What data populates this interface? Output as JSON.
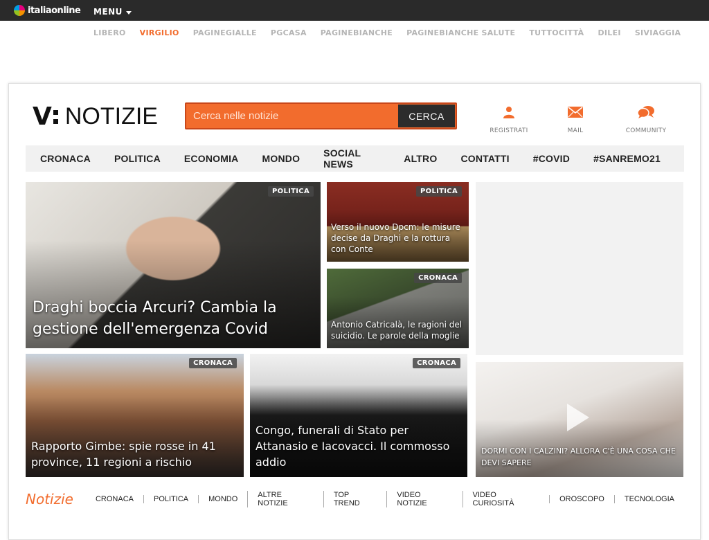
{
  "topbar": {
    "logo_text": "italiaonline",
    "menu_label": "MENU"
  },
  "network": [
    {
      "label": "LIBERO",
      "active": false
    },
    {
      "label": "VIRGILIO",
      "active": true
    },
    {
      "label": "PAGINEGIALLE",
      "active": false
    },
    {
      "label": "PGCASA",
      "active": false
    },
    {
      "label": "PAGINEBIANCHE",
      "active": false
    },
    {
      "label": "PAGINEBIANCHE SALUTE",
      "active": false
    },
    {
      "label": "TUTTOCITTÀ",
      "active": false
    },
    {
      "label": "DILEI",
      "active": false
    },
    {
      "label": "SIVIAGGIA",
      "active": false
    }
  ],
  "brand": {
    "letter": "V",
    "name": "NOTIZIE"
  },
  "search": {
    "placeholder": "Cerca nelle notizie",
    "button_label": "CERCA"
  },
  "utilities": [
    {
      "label": "REGISTRATI",
      "icon": "user-icon"
    },
    {
      "label": "MAIL",
      "icon": "envelope-icon"
    },
    {
      "label": "COMMUNITY",
      "icon": "chat-bubbles-icon"
    }
  ],
  "categories": [
    "CRONACA",
    "POLITICA",
    "ECONOMIA",
    "MONDO",
    "SOCIAL NEWS",
    "ALTRO",
    "CONTATTI",
    "#COVID",
    "#SANREMO21"
  ],
  "articles": {
    "main": {
      "tag": "POLITICA",
      "title": "Draghi boccia Arcuri? Cambia la gestione dell'emergenza Covid"
    },
    "top_right_1": {
      "tag": "POLITICA",
      "title": "Verso il nuovo Dpcm: le misure decise da Draghi e la rottura con Conte"
    },
    "top_right_2": {
      "tag": "CRONACA",
      "title": "Antonio Catricalà, le ragioni del suicidio. Le parole della moglie"
    },
    "bottom_1": {
      "tag": "CRONACA",
      "title": "Rapporto Gimbe: spie rosse in 41 province, 11 regioni a rischio"
    },
    "bottom_2": {
      "tag": "CRONACA",
      "title": "Congo, funerali di Stato per Attanasio e Iacovacci. Il commosso addio"
    },
    "promo": {
      "title": "DORMI CON I CALZINI? ALLORA C'È UNA COSA CHE DEVI SAPERE"
    }
  },
  "bottom_nav": {
    "title": "Notizie",
    "items": [
      "CRONACA",
      "POLITICA",
      "MONDO",
      "ALTRE NOTIZIE",
      "TOP TREND",
      "VIDEO NOTIZIE",
      "VIDEO CURIOSITÀ",
      "OROSCOPO",
      "TECNOLOGIA"
    ]
  },
  "colors": {
    "accent": "#f26c2d",
    "topbar": "#2a2a2a",
    "text": "#222222"
  }
}
